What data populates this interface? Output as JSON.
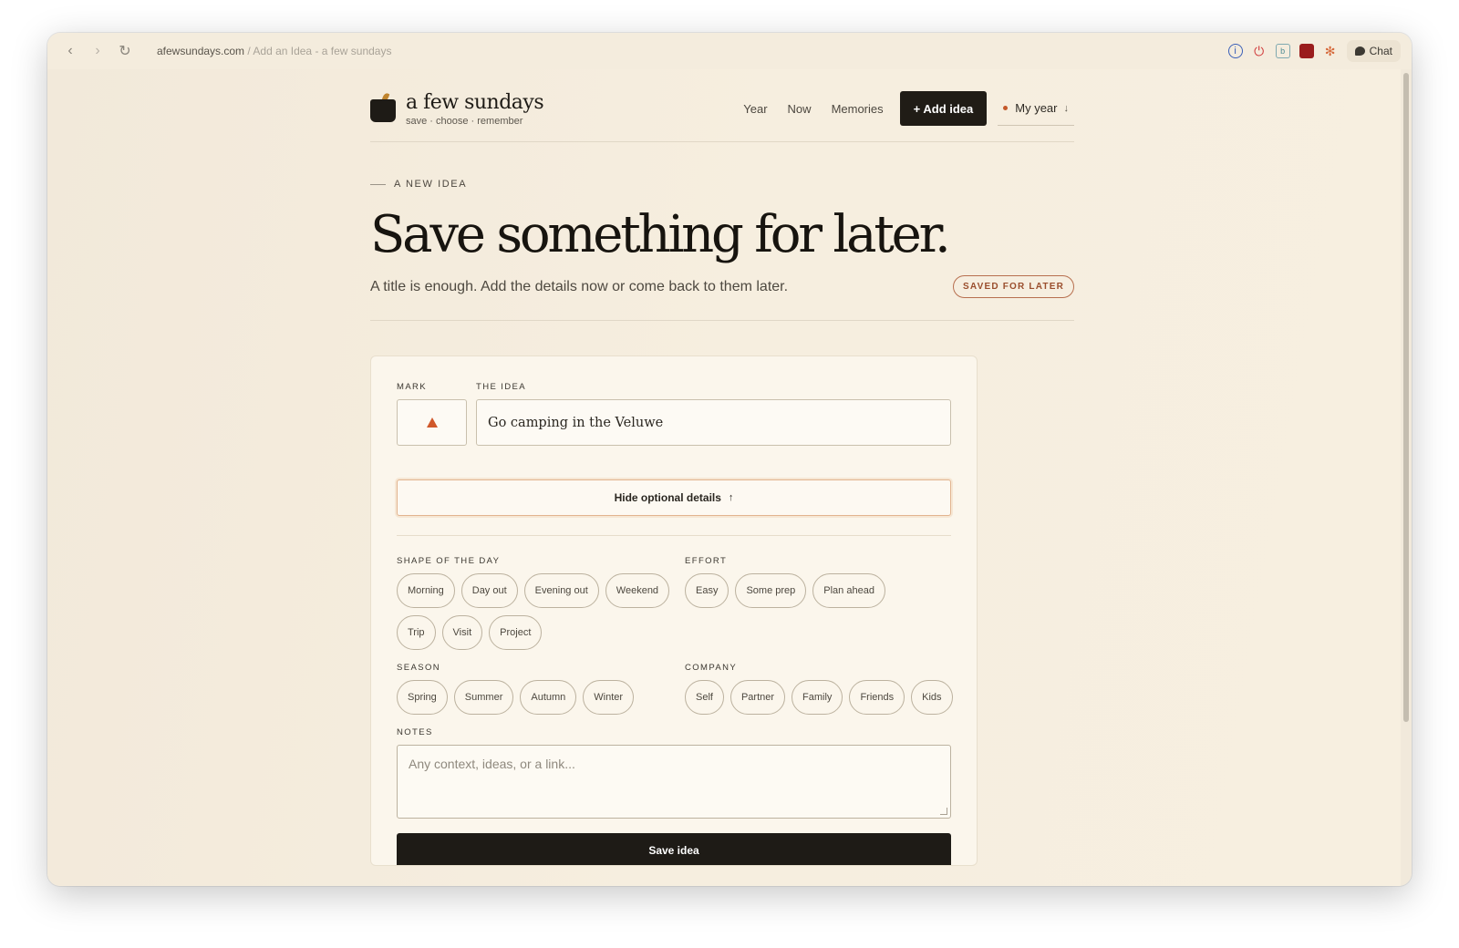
{
  "browser": {
    "url_domain": "afewsundays.com",
    "url_rest": " / Add an Idea - a few sundays",
    "chat_label": "Chat"
  },
  "header": {
    "logo_name": "a few sundays",
    "logo_tagline": "save · choose · remember",
    "nav": [
      "Year",
      "Now",
      "Memories"
    ],
    "add_button": "+ Add idea",
    "year_button": "My year",
    "year_arrow": "↓"
  },
  "hero": {
    "eyebrow": "A NEW IDEA",
    "title": "Save something for later.",
    "subtitle": "A title is enough. Add the details now or come back to them later.",
    "badge": "SAVED FOR LATER"
  },
  "form": {
    "mark_label": "MARK",
    "idea_label": "THE IDEA",
    "idea_value": "Go camping in the Veluwe",
    "toggle_label": "Hide optional details",
    "toggle_arrow": "↑",
    "shape_label": "SHAPE OF THE DAY",
    "shape_options": [
      "Morning",
      "Day out",
      "Evening out",
      "Weekend",
      "Trip",
      "Visit",
      "Project"
    ],
    "effort_label": "EFFORT",
    "effort_options": [
      "Easy",
      "Some prep",
      "Plan ahead"
    ],
    "season_label": "SEASON",
    "season_options": [
      "Spring",
      "Summer",
      "Autumn",
      "Winter"
    ],
    "company_label": "COMPANY",
    "company_options": [
      "Self",
      "Partner",
      "Family",
      "Friends",
      "Kids"
    ],
    "notes_label": "NOTES",
    "notes_placeholder": "Any context, ideas, or a link...",
    "save_label": "Save idea"
  },
  "colors": {
    "accent": "#c4582a",
    "primary_dark": "#1e1b16",
    "background": "#f4ecdd"
  }
}
